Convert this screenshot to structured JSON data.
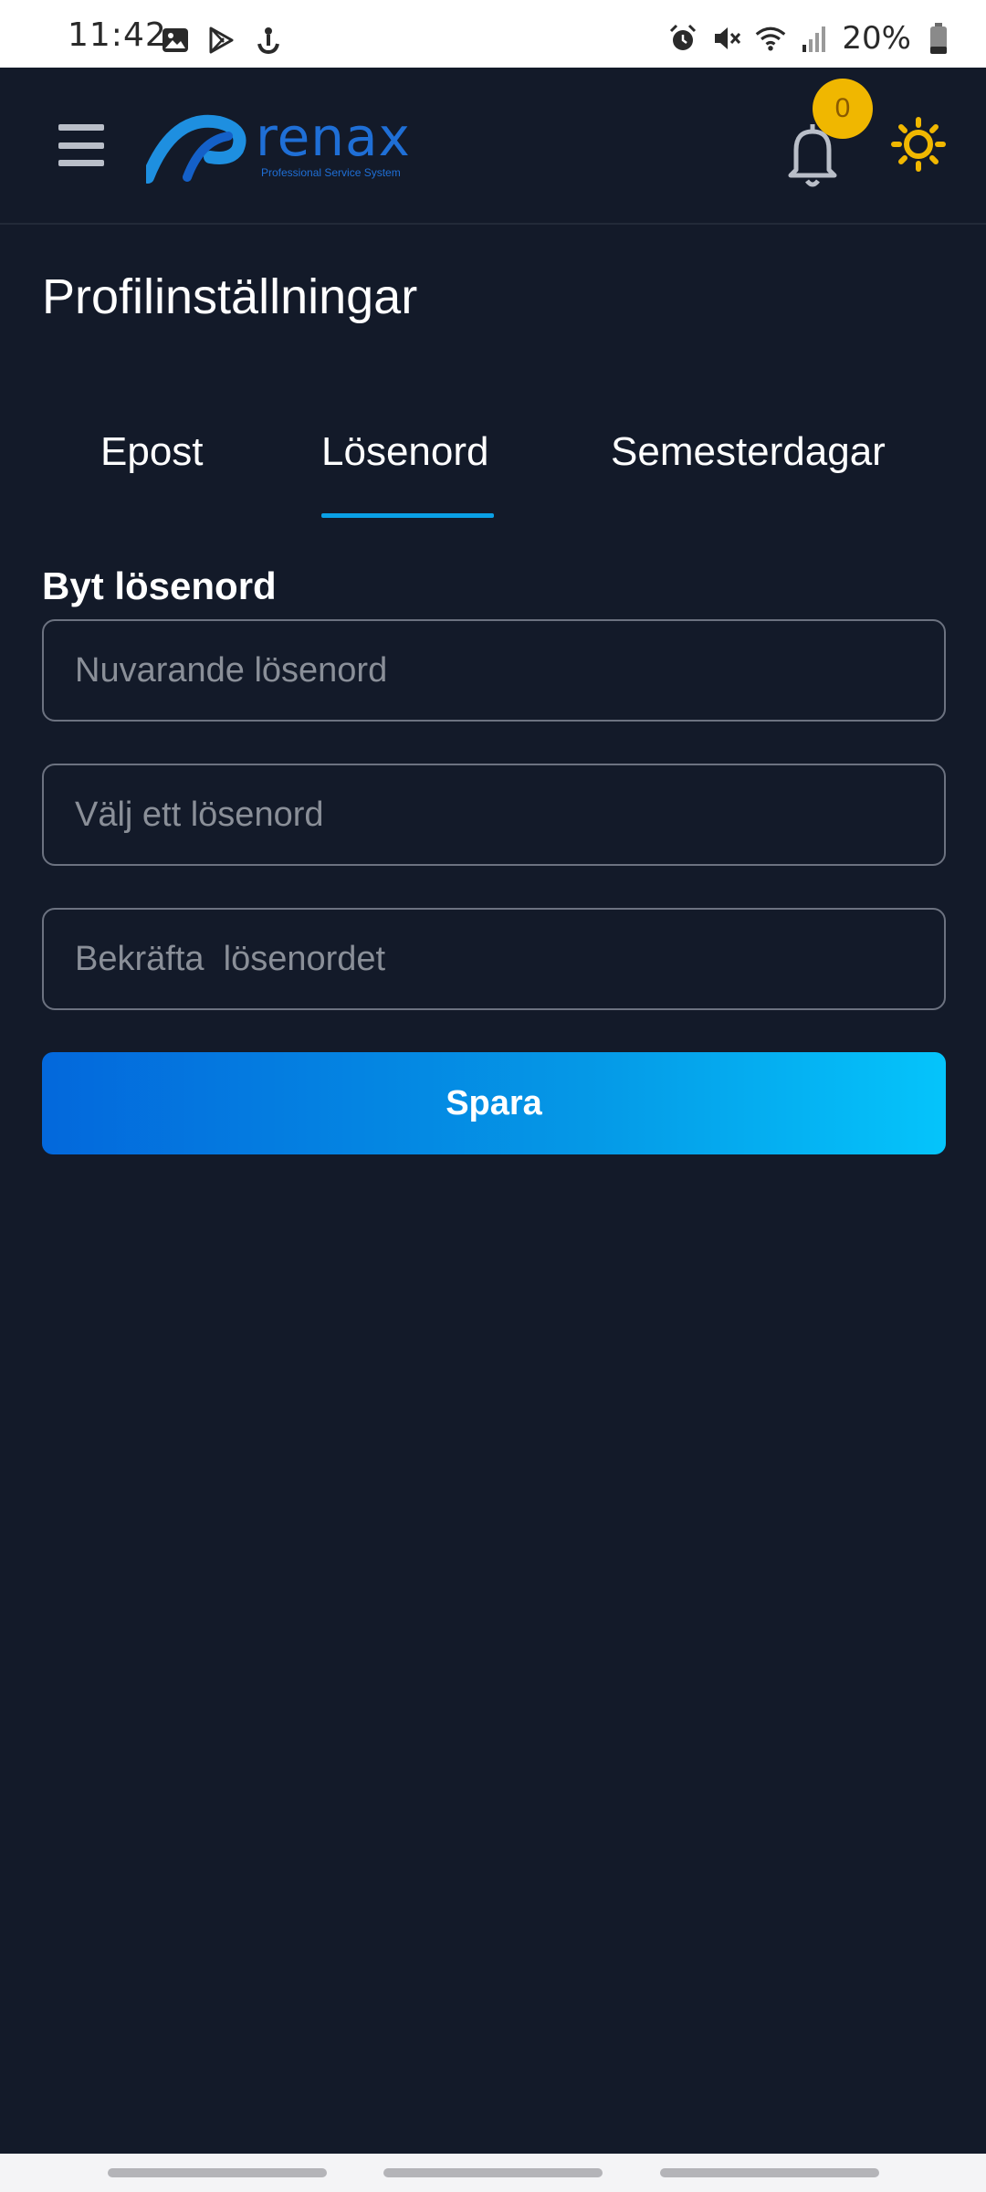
{
  "status_bar": {
    "time": "11:42",
    "left_icons": [
      "image-icon",
      "play-store-icon",
      "anchor-icon"
    ],
    "right_icons": [
      "alarm-icon",
      "mute-icon",
      "wifi-icon",
      "signal-icon"
    ],
    "battery": "20%"
  },
  "header": {
    "logo_text": "renax",
    "logo_tagline": "Professional Service System",
    "notification_count": "0",
    "accent_color": "#f0b700"
  },
  "page": {
    "title": "Profilinställningar"
  },
  "tabs": [
    {
      "label": "Epost",
      "active": false
    },
    {
      "label": "Lösenord",
      "active": true
    },
    {
      "label": "Semesterdagar",
      "active": false
    }
  ],
  "form": {
    "section_title": "Byt lösenord",
    "current_password_placeholder": "Nuvarande lösenord",
    "new_password_placeholder": "Välj ett lösenord",
    "confirm_password_placeholder": "Bekräfta  lösenordet",
    "save_label": "Spara"
  }
}
